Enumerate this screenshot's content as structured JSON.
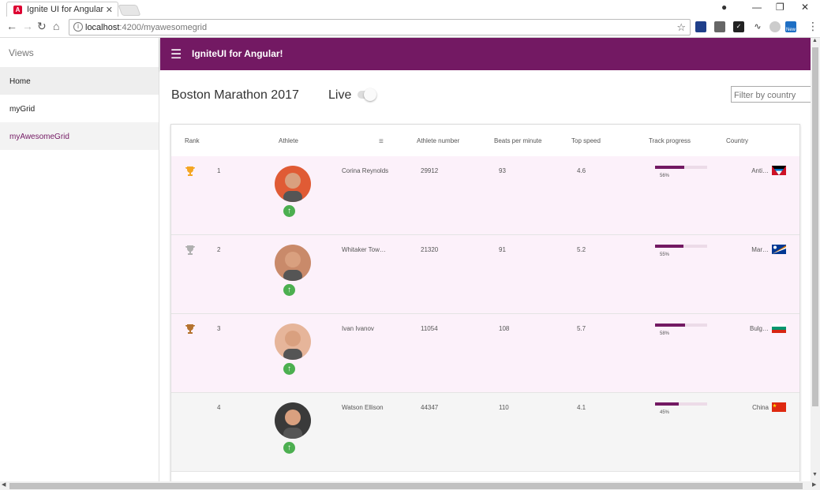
{
  "browser": {
    "tab_title": "Ignite UI for Angular",
    "url_host": "localhost",
    "url_path": ":4200/myawesomegrid",
    "ext_new_badge": "New"
  },
  "sidebar": {
    "heading": "Views",
    "items": [
      {
        "label": "Home"
      },
      {
        "label": "myGrid"
      },
      {
        "label": "myAwesomeGrid"
      }
    ]
  },
  "appbar": {
    "title": "IgniteUI for Angular!"
  },
  "page": {
    "title": "Boston Marathon 2017",
    "live_label": "Live",
    "filter_placeholder": "Filter by country"
  },
  "grid": {
    "columns": {
      "rank": "Rank",
      "athlete": "Athlete",
      "athlete_number": "Athlete number",
      "bpm": "Beats per minute",
      "top_speed": "Top speed",
      "track_progress": "Track progress",
      "country": "Country"
    },
    "rows": [
      {
        "rank": "1",
        "name": "Corina Reynolds",
        "number": "29912",
        "bpm": "93",
        "speed": "4.6",
        "progress": 56,
        "progress_label": "56%",
        "country": "Anti…",
        "trophy_color": "#f4a623",
        "flag": "antigua",
        "avatar_bg": "#e05b35"
      },
      {
        "rank": "2",
        "name": "Whitaker Tow…",
        "number": "21320",
        "bpm": "91",
        "speed": "5.2",
        "progress": 55,
        "progress_label": "55%",
        "country": "Mar…",
        "trophy_color": "#b0b0b0",
        "flag": "marshall",
        "avatar_bg": "#c98a6a"
      },
      {
        "rank": "3",
        "name": "Ivan Ivanov",
        "number": "11054",
        "bpm": "108",
        "speed": "5.7",
        "progress": 58,
        "progress_label": "58%",
        "country": "Bulg…",
        "trophy_color": "#b5732f",
        "flag": "bulgaria",
        "avatar_bg": "#e6b59a"
      },
      {
        "rank": "4",
        "name": "Watson Ellison",
        "number": "44347",
        "bpm": "110",
        "speed": "4.1",
        "progress": 45,
        "progress_label": "45%",
        "country": "China",
        "trophy_color": "",
        "flag": "china",
        "avatar_bg": "#3a3a3a"
      }
    ]
  }
}
